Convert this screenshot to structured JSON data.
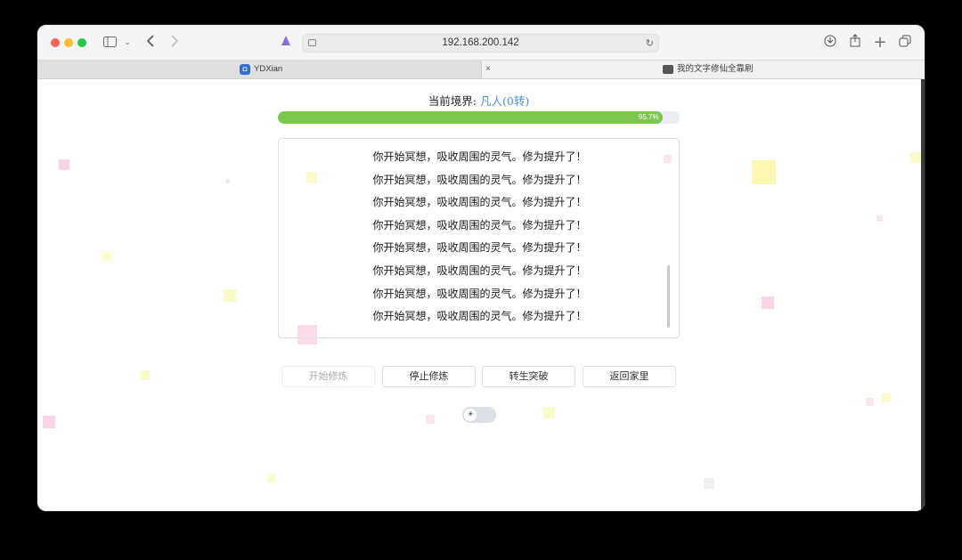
{
  "browser": {
    "address_url": "192.168.200.142",
    "tabs": [
      {
        "title": "YDXian",
        "active": true
      },
      {
        "title": "我的文字修仙全靠刷",
        "active": false
      }
    ],
    "tab_close_glyph": "×"
  },
  "game": {
    "realm_label": "当前境界:",
    "realm_value": "凡人(0转)",
    "progress_percent": 95.7,
    "progress_text": "95.7%",
    "log_lines": [
      "你开始冥想，吸收周围的灵气。修为提升了！",
      "你开始冥想，吸收周围的灵气。修为提升了！",
      "你开始冥想，吸收周围的灵气。修为提升了！",
      "你开始冥想，吸收周围的灵气。修为提升了！",
      "你开始冥想，吸收周围的灵气。修为提升了！",
      "你开始冥想，吸收周围的灵气。修为提升了！",
      "你开始冥想，吸收周围的灵气。修为提升了！",
      "你开始冥想，吸收周围的灵气。修为提升了！"
    ],
    "buttons": {
      "start": "开始修炼",
      "stop": "停止修炼",
      "rebirth": "转生突破",
      "home": "返回家里"
    },
    "theme_toggle_icon": "sun-icon"
  },
  "colors": {
    "progress_fill": "#7cc652",
    "realm_value": "#4a8ee0"
  }
}
